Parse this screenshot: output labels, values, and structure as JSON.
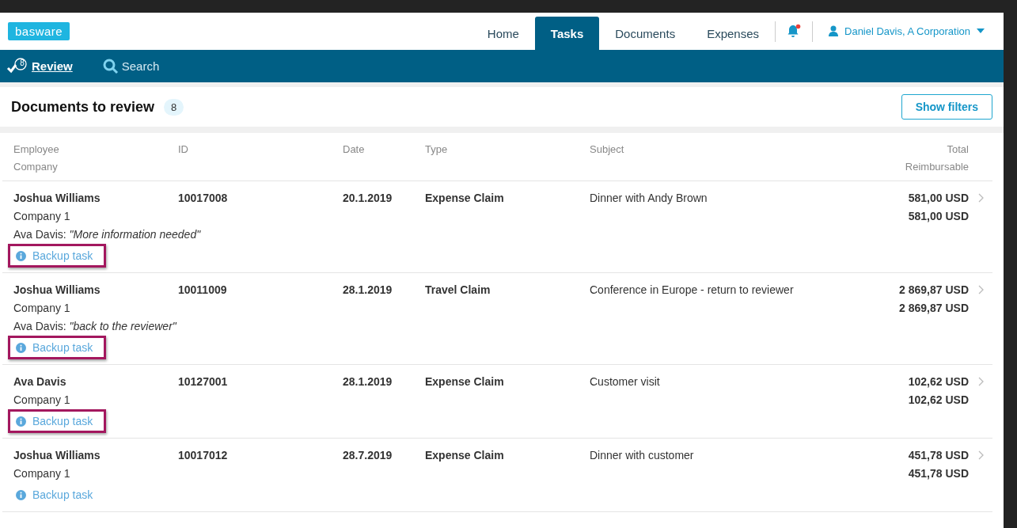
{
  "header": {
    "logo": "basware",
    "nav": [
      {
        "label": "Home",
        "selected": false
      },
      {
        "label": "Tasks",
        "selected": true
      },
      {
        "label": "Documents",
        "selected": false
      },
      {
        "label": "Expenses",
        "selected": false
      }
    ],
    "notifications": {
      "unread": true
    },
    "user": "Daniel Davis, A Corporation"
  },
  "subnav": [
    {
      "kind": "review",
      "label": "Review",
      "count": "8",
      "selected": true
    },
    {
      "kind": "search",
      "label": "Search",
      "selected": false
    }
  ],
  "panel": {
    "title": "Documents to review",
    "count": "8",
    "filter_button": "Show filters"
  },
  "table": {
    "columns": [
      {
        "line1": "Employee",
        "line2": "Company"
      },
      {
        "line1": "ID"
      },
      {
        "line1": "Date"
      },
      {
        "line1": "Type"
      },
      {
        "line1": "Subject"
      },
      {
        "line1": "Total",
        "line2": "Reimbursable"
      }
    ],
    "rows": [
      {
        "employee": "Joshua Williams",
        "company": "Company 1",
        "comment": "Ava Davis: *\"More information needed\"*",
        "id": "10017008",
        "date": "20.1.2019",
        "type": "Expense Claim",
        "subject": "Dinner with Andy Brown",
        "total": "581,00 USD",
        "reimbursable": "581,00 USD",
        "backup": "Backup task",
        "highlighted": true
      },
      {
        "employee": "Joshua Williams",
        "company": "Company 1",
        "comment": "Ava Davis: *\"back to the reviewer\"*",
        "id": "10011009",
        "date": "28.1.2019",
        "type": "Travel Claim",
        "subject": "Conference in Europe - return to reviewer",
        "total": "2 869,87 USD",
        "reimbursable": "2 869,87 USD",
        "backup": "Backup task",
        "highlighted": true
      },
      {
        "employee": "Ava Davis",
        "company": "Company 1",
        "id": "10127001",
        "date": "28.1.2019",
        "type": "Expense Claim",
        "subject": "Customer visit",
        "total": "102,62 USD",
        "reimbursable": "102,62 USD",
        "backup": "Backup task",
        "highlighted": true
      },
      {
        "employee": "Joshua Williams",
        "company": "Company 1",
        "id": "10017012",
        "date": "28.7.2019",
        "type": "Expense Claim",
        "subject": "Dinner with customer",
        "total": "451,78 USD",
        "reimbursable": "451,78 USD",
        "backup": "Backup task",
        "highlighted": false
      }
    ]
  }
}
